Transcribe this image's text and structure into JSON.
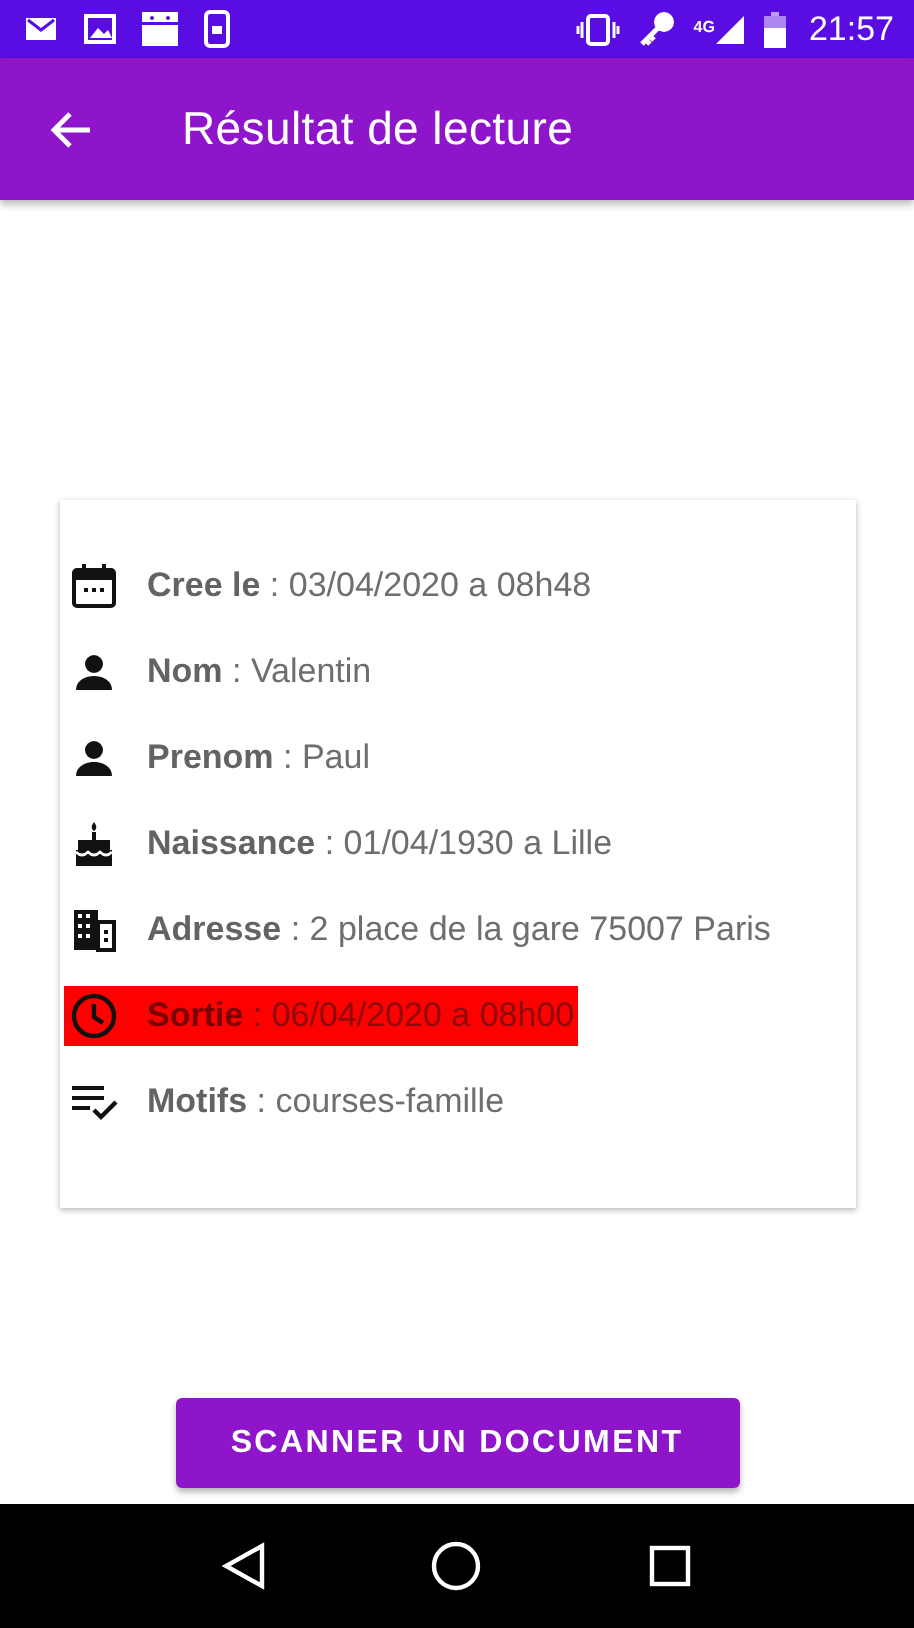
{
  "status_bar": {
    "network_label": "4G",
    "time": "21:57"
  },
  "app_bar": {
    "title": "Résultat de lecture"
  },
  "fields": [
    {
      "kind": "calendar",
      "text": "**Cree le** : 03/04/2020 a 08h48",
      "alert": false
    },
    {
      "kind": "person",
      "text": "**Nom** : Valentin",
      "alert": false
    },
    {
      "kind": "person",
      "text": "**Prenom** : Paul",
      "alert": false
    },
    {
      "kind": "cake",
      "text": "**Naissance** : 01/04/1930 a Lille",
      "alert": false
    },
    {
      "kind": "building",
      "text": "**Adresse** : 2 place de la gare 75007 Paris",
      "alert": false
    },
    {
      "kind": "clock",
      "text": "**Sortie** : 06/04/2020 a 08h00",
      "alert": true
    },
    {
      "kind": "checklist",
      "text": "**Motifs** : courses-famille",
      "alert": false
    }
  ],
  "button": {
    "label": "SCANNER UN DOCUMENT"
  }
}
